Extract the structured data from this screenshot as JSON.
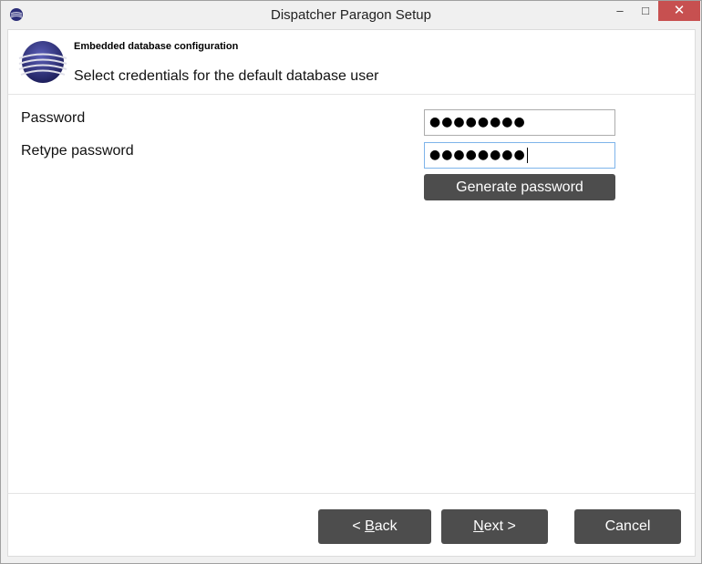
{
  "window": {
    "title": "Dispatcher Paragon Setup",
    "controls": {
      "minimize": "–",
      "maximize": "□",
      "close": "✕"
    }
  },
  "header": {
    "title": "Embedded database configuration",
    "subtitle": "Select credentials for the default database user"
  },
  "form": {
    "password_label": "Password",
    "password_value": "●●●●●●●●",
    "retype_label": "Retype password",
    "retype_value": "●●●●●●●●",
    "generate_label": "Generate password"
  },
  "footer": {
    "back_prefix": "< ",
    "back_mnemonic": "B",
    "back_rest": "ack",
    "next_mnemonic": "N",
    "next_rest": "ext >",
    "cancel_label": "Cancel"
  },
  "colors": {
    "button_bg": "#4d4d4d",
    "close_bg": "#c75050",
    "logo": "#2b2d78"
  },
  "icons": [
    "app-icon",
    "paragon-logo"
  ]
}
